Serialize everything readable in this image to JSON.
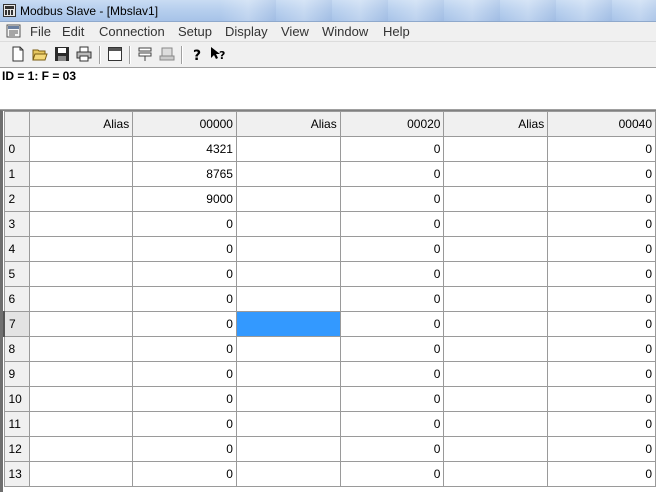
{
  "window": {
    "title": "Modbus Slave - [Mbslav1]"
  },
  "menu": {
    "items": [
      "File",
      "Edit",
      "Connection",
      "Setup",
      "Display",
      "View",
      "Window",
      "Help"
    ]
  },
  "toolbar": {
    "buttons": [
      "new-icon",
      "open-icon",
      "save-icon",
      "print-icon",
      "window-icon",
      "slave-definition-icon",
      "connect-icon",
      "help-icon",
      "context-help-icon"
    ]
  },
  "document": {
    "header": "ID = 1: F = 03",
    "columns": [
      "Alias",
      "00000",
      "Alias",
      "00020",
      "Alias",
      "00040"
    ],
    "rows": [
      {
        "num": "0",
        "v1": "4321",
        "v2": "0",
        "v3": "0"
      },
      {
        "num": "1",
        "v1": "8765",
        "v2": "0",
        "v3": "0"
      },
      {
        "num": "2",
        "v1": "9000",
        "v2": "0",
        "v3": "0"
      },
      {
        "num": "3",
        "v1": "0",
        "v2": "0",
        "v3": "0"
      },
      {
        "num": "4",
        "v1": "0",
        "v2": "0",
        "v3": "0"
      },
      {
        "num": "5",
        "v1": "0",
        "v2": "0",
        "v3": "0"
      },
      {
        "num": "6",
        "v1": "0",
        "v2": "0",
        "v3": "0"
      },
      {
        "num": "7",
        "v1": "0",
        "v2": "0",
        "v3": "0"
      },
      {
        "num": "8",
        "v1": "0",
        "v2": "0",
        "v3": "0"
      },
      {
        "num": "9",
        "v1": "0",
        "v2": "0",
        "v3": "0"
      },
      {
        "num": "10",
        "v1": "0",
        "v2": "0",
        "v3": "0"
      },
      {
        "num": "11",
        "v1": "0",
        "v2": "0",
        "v3": "0"
      },
      {
        "num": "12",
        "v1": "0",
        "v2": "0",
        "v3": "0"
      },
      {
        "num": "13",
        "v1": "0",
        "v2": "0",
        "v3": "0"
      }
    ],
    "selected_row": "7",
    "selection_color": "#3399ff"
  }
}
